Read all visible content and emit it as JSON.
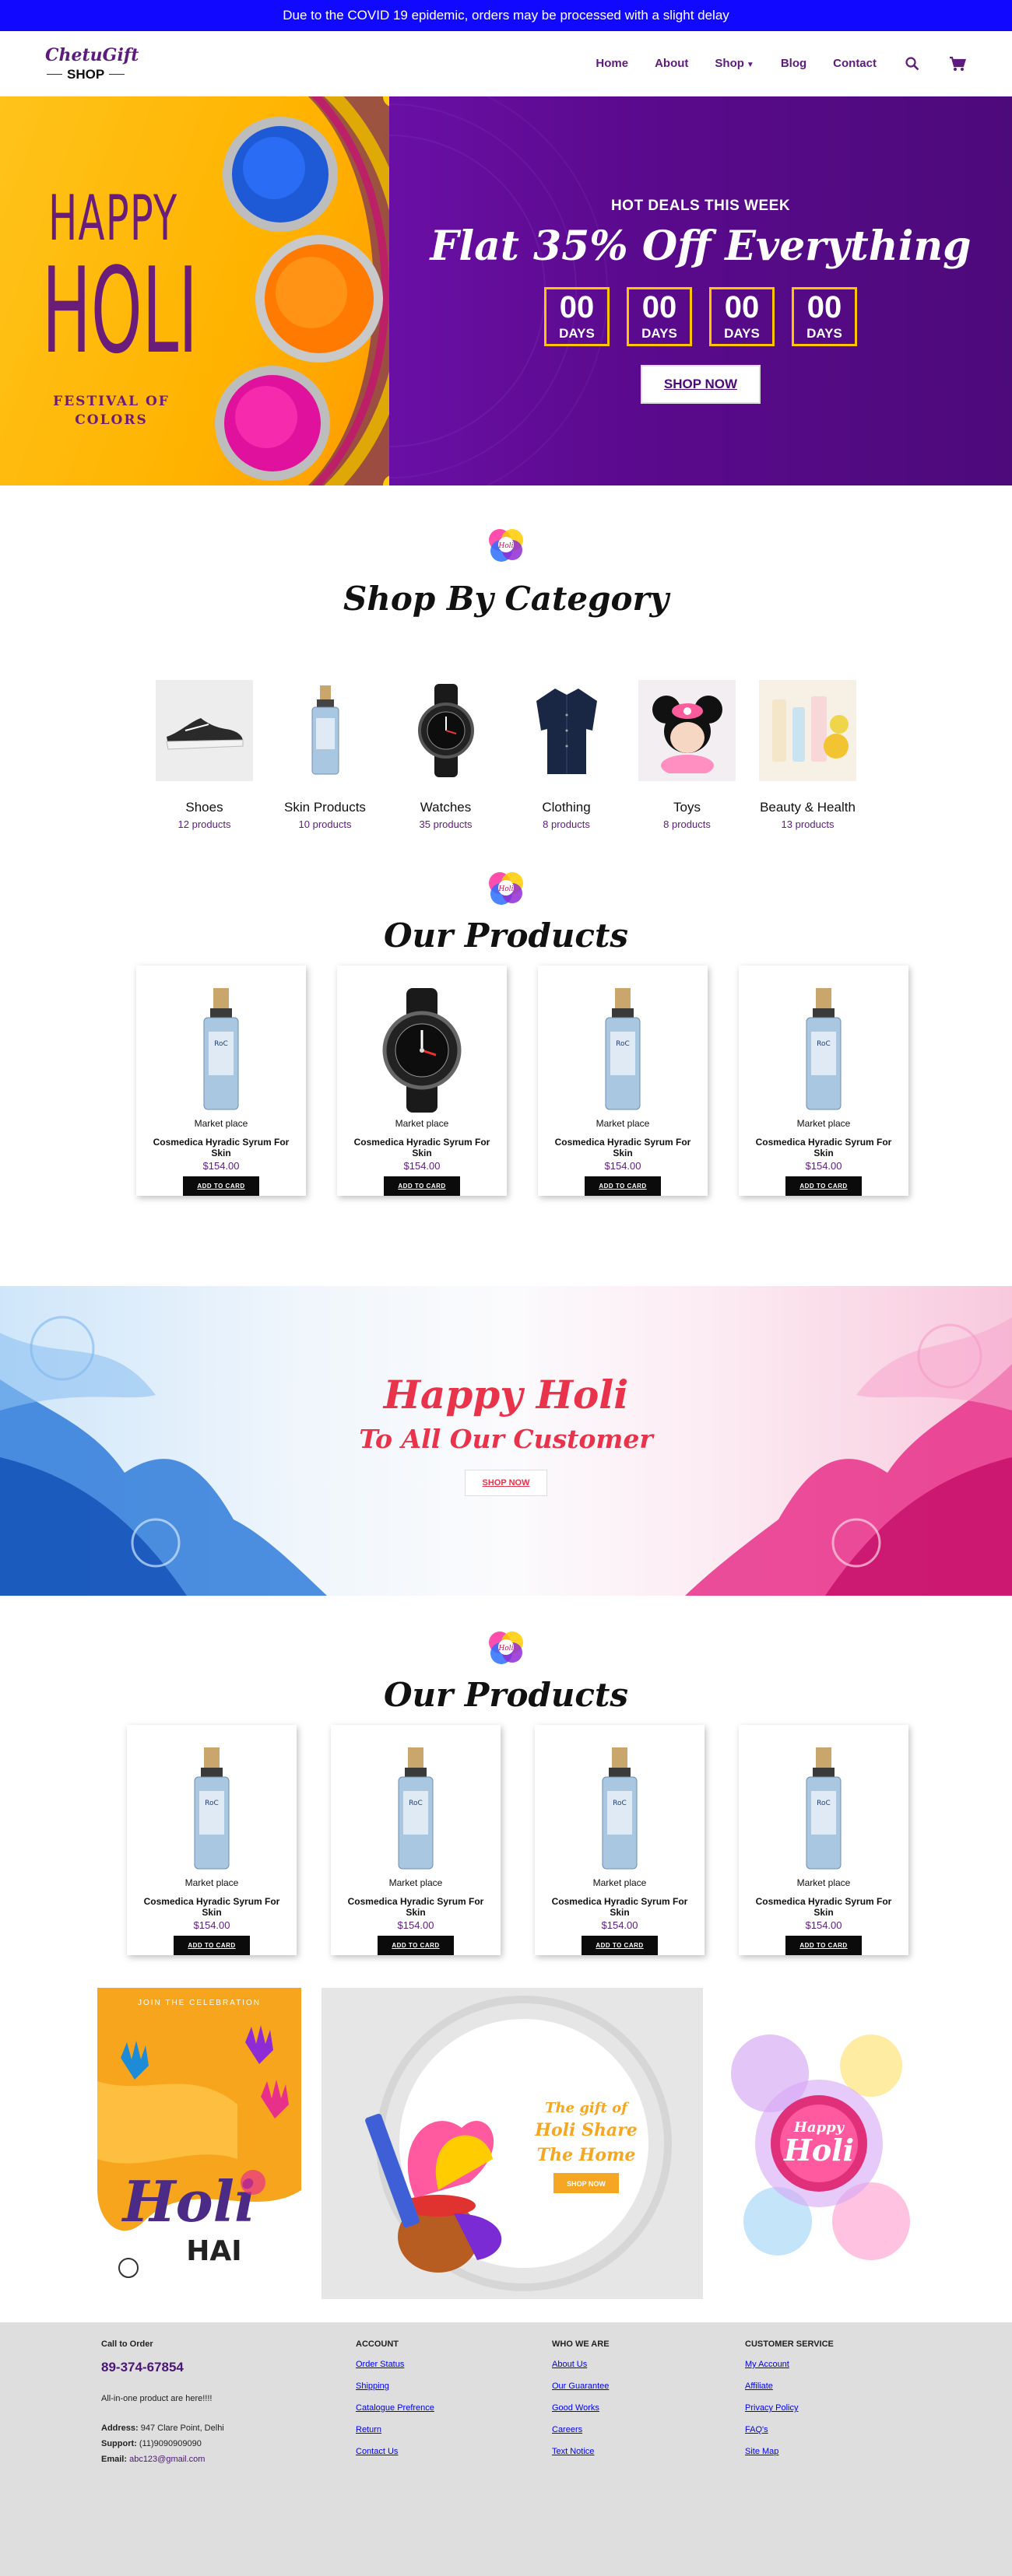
{
  "announcement": "Due to the COVID 19 epidemic, orders may be processed with a slight delay",
  "logo": {
    "script": "ChetuGift",
    "word": "SHOP"
  },
  "nav": {
    "items": [
      "Home",
      "About",
      "Shop",
      "Blog",
      "Contact"
    ],
    "icons": [
      "search-icon",
      "cart-icon"
    ]
  },
  "hero": {
    "art_line1": "HAPPY",
    "art_line2": "HOLI",
    "art_tagline_1": "FESTIVAL OF",
    "art_tagline_2": "COLORS",
    "kicker": "HOT DEALS THIS WEEK",
    "headline": "Flat 35% Off Everything",
    "countdown": [
      {
        "value": "00",
        "label": "DAYS"
      },
      {
        "value": "00",
        "label": "DAYS"
      },
      {
        "value": "00",
        "label": "DAYS"
      },
      {
        "value": "00",
        "label": "DAYS"
      }
    ],
    "cta": "SHOP NOW"
  },
  "section_mark": "Holi",
  "categories": {
    "title": "Shop By Category",
    "items": [
      {
        "name": "Shoes",
        "count": "12 products"
      },
      {
        "name": "Skin Products",
        "count": "10 products"
      },
      {
        "name": "Watches",
        "count": "35 products"
      },
      {
        "name": "Clothing",
        "count": "8 products"
      },
      {
        "name": "Toys",
        "count": "8 products"
      },
      {
        "name": "Beauty & Health",
        "count": "13 products"
      }
    ]
  },
  "products_1": {
    "title": "Our Products",
    "cards": [
      {
        "type": "serum",
        "market": "Market place",
        "name": "Cosmedica Hyradic Syrum For Skin",
        "price": "$154.00",
        "cta": "ADD TO CARD"
      },
      {
        "type": "watch",
        "market": "Market place",
        "name": "Cosmedica Hyradic Syrum For Skin",
        "price": "$154.00",
        "cta": "ADD TO CARD"
      },
      {
        "type": "serum",
        "market": "Market place",
        "name": "Cosmedica Hyradic Syrum For Skin",
        "price": "$154.00",
        "cta": "ADD TO CARD"
      },
      {
        "type": "serum",
        "market": "Market place",
        "name": "Cosmedica Hyradic Syrum For Skin",
        "price": "$154.00",
        "cta": "ADD TO CARD"
      }
    ]
  },
  "holi_banner": {
    "title": "Happy Holi",
    "subtitle": "To All Our Customer",
    "cta": "SHOP NOW"
  },
  "products_2": {
    "title": "Our Products",
    "cards": [
      {
        "market": "Market place",
        "name": "Cosmedica Hyradic Syrum For Skin",
        "price": "$154.00",
        "cta": "ADD TO CARD"
      },
      {
        "market": "Market place",
        "name": "Cosmedica Hyradic Syrum For Skin",
        "price": "$154.00",
        "cta": "ADD TO CARD"
      },
      {
        "market": "Market place",
        "name": "Cosmedica Hyradic Syrum For Skin",
        "price": "$154.00",
        "cta": "ADD TO CARD"
      },
      {
        "market": "Market place",
        "name": "Cosmedica Hyradic Syrum For Skin",
        "price": "$154.00",
        "cta": "ADD TO CARD"
      }
    ]
  },
  "promos": {
    "left": {
      "kicker": "JOIN THE CELEBRATION",
      "text_1": "Holi",
      "text_2": "HAI"
    },
    "middle": {
      "line1": "The gift of",
      "line2": "Holi Share",
      "line3": "The Home",
      "cta": "SHOP NOW"
    },
    "right": {
      "line1": "Happy",
      "line2": "Holi"
    }
  },
  "footer": {
    "call": {
      "heading": "Call to Order",
      "phone": "89-374-67854",
      "tagline": "All-in-one product are here!!!!",
      "address_label": "Address:",
      "address": "947 Clare Point, Delhi",
      "support_label": "Support:",
      "support": "(11)9090909090",
      "email_label": "Email:",
      "email": "abc123@gmail.com"
    },
    "account": {
      "heading": "ACCOUNT",
      "links": [
        "Order Status",
        "Shipping",
        "Catalogue Prefrence",
        "Return",
        "Contact Us"
      ]
    },
    "who": {
      "heading": "WHO WE ARE",
      "links": [
        "About Us",
        "Our Guarantee",
        "Good Works",
        "Careers",
        "Text Notice"
      ]
    },
    "service": {
      "heading": "CUSTOMER SERVICE",
      "links": [
        "My Account",
        "Affiliate",
        "Privacy Policy",
        "FAQ's",
        "Site Map"
      ]
    }
  },
  "colors": {
    "announcement_bg": "#1109ff",
    "brand_purple": "#5d1b7d",
    "hero_purple": "#5a0a8d",
    "hero_yellow": "#ffb300",
    "countdown_border": "#ffc400",
    "banner_red": "#e8334a",
    "footer_bg": "#dedede"
  }
}
